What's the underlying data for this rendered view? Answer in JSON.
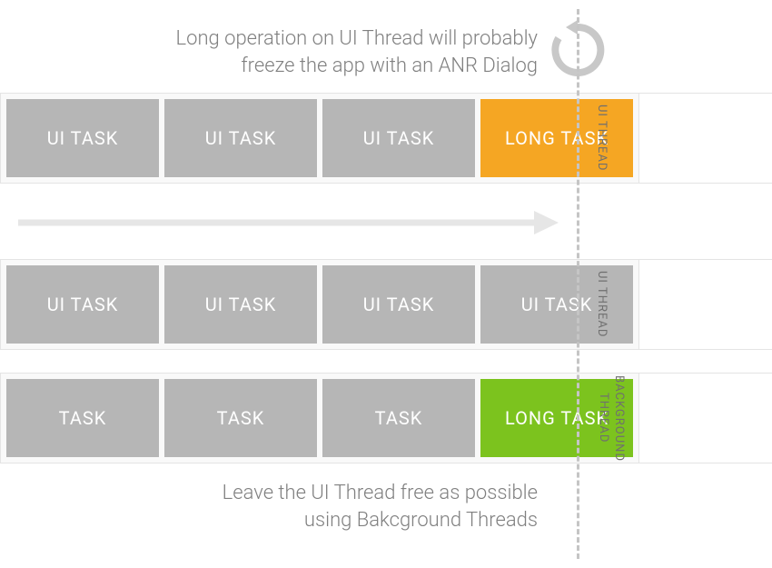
{
  "topCaption": {
    "line1": "Long operation on UI Thread will probably",
    "line2": "freeze the app with an ANR Dialog"
  },
  "bottomCaption": {
    "line1": "Leave the UI Thread free as possible",
    "line2": "using Bakcground Threads"
  },
  "rows": [
    {
      "label": "UI THREAD",
      "tasks": [
        {
          "text": "UI TASK",
          "color": "grey"
        },
        {
          "text": "UI TASK",
          "color": "grey"
        },
        {
          "text": "UI TASK",
          "color": "grey"
        },
        {
          "text": "LONG TASK",
          "color": "orange"
        }
      ]
    },
    {
      "label": "UI THREAD",
      "tasks": [
        {
          "text": "UI TASK",
          "color": "grey"
        },
        {
          "text": "UI TASK",
          "color": "grey"
        },
        {
          "text": "UI TASK",
          "color": "grey"
        },
        {
          "text": "UI TASK",
          "color": "grey"
        }
      ]
    },
    {
      "label": "BACKGROUND THREAD",
      "tasks": [
        {
          "text": "TASK",
          "color": "grey"
        },
        {
          "text": "TASK",
          "color": "grey"
        },
        {
          "text": "TASK",
          "color": "grey"
        },
        {
          "text": "LONG TASK",
          "color": "green"
        }
      ]
    }
  ],
  "colors": {
    "grey": "#b6b6b6",
    "orange": "#f5a623",
    "green": "#7cc31e"
  }
}
